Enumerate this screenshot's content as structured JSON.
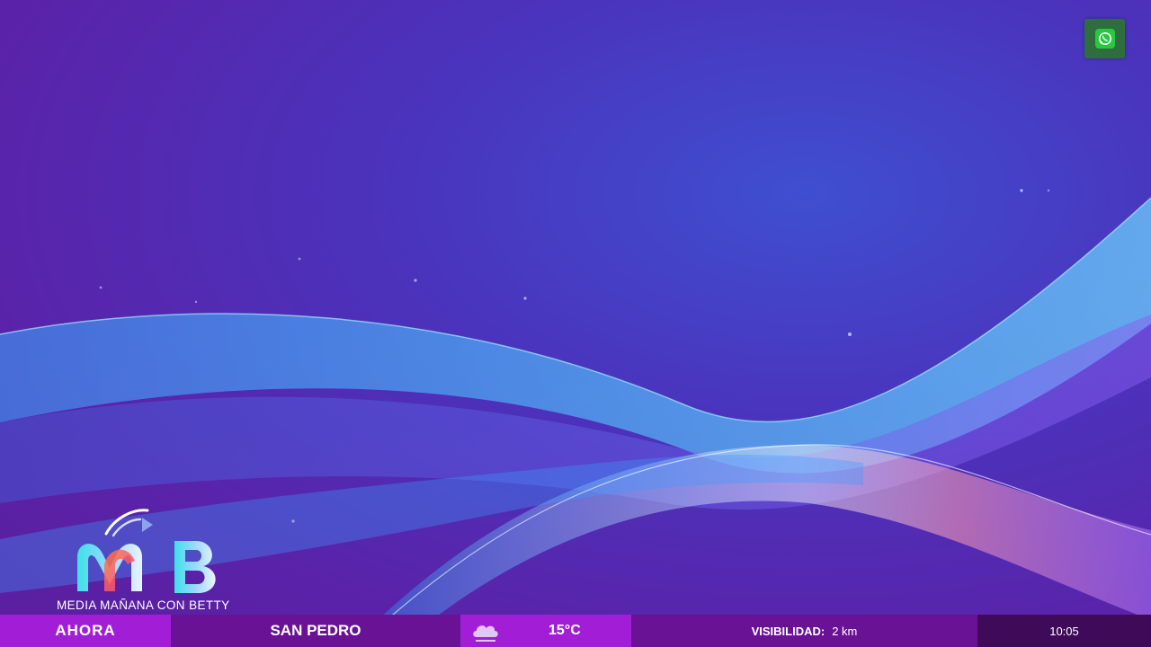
{
  "logo": {
    "tagline": "MEDIA MAÑANA CON BETTY"
  },
  "ticker": {
    "now_label": "AHORA",
    "city": "SAN PEDRO",
    "weather_icon": "cloud-icon",
    "temperature": "15°C",
    "visibility_label": "VISIBILIDAD:",
    "visibility_value": "2 km",
    "time": "10:05"
  },
  "colors": {
    "ticker_accent": "#a21ed6",
    "ticker_dark": "#6a1295",
    "ticker_clock": "#3f0b58",
    "whatsapp": "#2f6d3f"
  }
}
